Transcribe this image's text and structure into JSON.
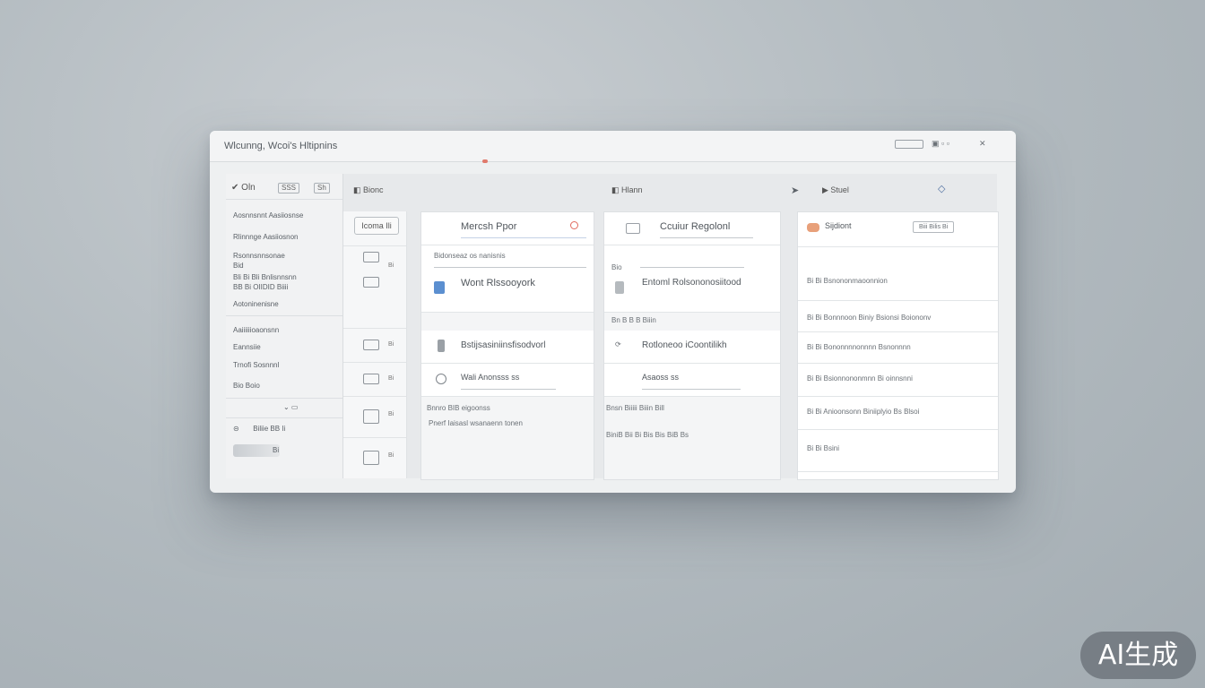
{
  "window": {
    "title": "Wlcunng, Wcoi's Hltipnins",
    "controls": [
      "minimize-icon",
      "restore-icon",
      "close-icon"
    ]
  },
  "sidebar": {
    "header": "Oln",
    "chips": [
      "SSS",
      "Sh"
    ],
    "items": [
      "Aosnnsnnt Aasiiosnse",
      "Rlinnnge Aasiiosnon",
      "Rsonnsnnsonae",
      "Bid",
      "Bli Bi Bli Bnlisnnsnn",
      "BB Bi OIIDID Biiii",
      "Aotoninenisne",
      "Aaiiiiiioaonsnn",
      "Eannsiie",
      "Trnofi Sosnnnl",
      "Bio Boio"
    ],
    "footer_item": "Biliie BB Ii",
    "footer_chip": "Bi"
  },
  "toolbar": {
    "left_label": "Bionc",
    "center_label": "Hlann",
    "right_label": "Stuel"
  },
  "iconcol": {
    "button": "Icoma Ili",
    "labels": [
      "Bi",
      "Bi",
      "Bi",
      "Bi",
      "Bi"
    ]
  },
  "panel1": {
    "title": "Mercsh Ppor",
    "sub": "Bidonseaz os nanisnis",
    "rows": [
      "Wont Rlssooyork",
      "Bstijsasiniinsfisodvorl",
      "Wali Anonsss ss"
    ],
    "footer": [
      "Bnnro BIB eigoonss",
      "Pnerf Iaisasl wsanaenn tonen"
    ]
  },
  "panel2": {
    "title": "Ccuiur Regolonl",
    "sub": "Bio",
    "rows": [
      "Entoml Rolsononosiitood",
      "Rotloneoo iCoontilikh",
      "Asaoss ss"
    ],
    "group_label": "Bn B B B Biiin",
    "footer": [
      "Bnsn Biiiii Biiin Bill",
      "BiniB Bii Bi Bis Bis BiB Bs"
    ]
  },
  "panel3": {
    "title": "Sijdiont",
    "button": "Biii Bilis Bi",
    "rows": [
      "Bi Bi Bsnononmaoonnion",
      "Bi Bi Bonnnoon Biniy Bsionsi Boiononv",
      "Bi Bi Bononnnnonnnn Bsnonnnn",
      "Bi Bi Bsionnononmnn Bi oinnsnni",
      "Bi Bi Anioonsonn Biniiplyio Bs Blsoi",
      "Bi Bi Bsini"
    ]
  },
  "badge": {
    "text": "AI生成"
  },
  "colors": {
    "accent_red": "#e06a5e",
    "accent_blue": "#5b8fd0",
    "accent_orange": "#e8a07a"
  }
}
